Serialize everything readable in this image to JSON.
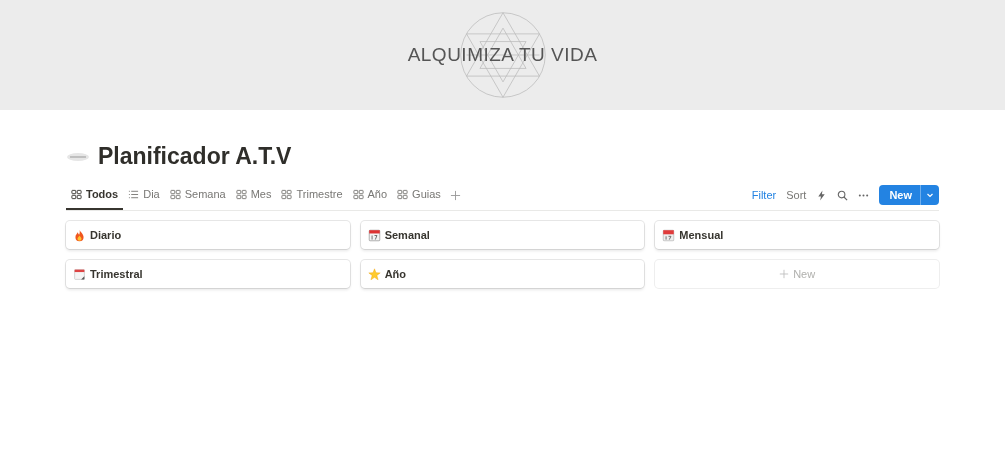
{
  "cover": {
    "title": "ALQUIMIZA TU VIDA"
  },
  "page": {
    "title": "Planificador A.T.V"
  },
  "tabs": [
    {
      "label": "Todos",
      "kind": "gallery",
      "selected": true
    },
    {
      "label": "Dia",
      "kind": "list",
      "selected": false
    },
    {
      "label": "Semana",
      "kind": "gallery",
      "selected": false
    },
    {
      "label": "Mes",
      "kind": "gallery",
      "selected": false
    },
    {
      "label": "Trimestre",
      "kind": "gallery",
      "selected": false
    },
    {
      "label": "Año",
      "kind": "gallery",
      "selected": false
    },
    {
      "label": "Guias",
      "kind": "gallery",
      "selected": false
    }
  ],
  "toolbar": {
    "filter": "Filter",
    "sort": "Sort",
    "new_button": "New"
  },
  "cards": [
    {
      "title": "Diario",
      "kind": "fire"
    },
    {
      "title": "Semanal",
      "kind": "calendar"
    },
    {
      "title": "Mensual",
      "kind": "date"
    },
    {
      "title": "Trimestral",
      "kind": "pad"
    },
    {
      "title": "Año",
      "kind": "star"
    }
  ],
  "new_card": "New"
}
